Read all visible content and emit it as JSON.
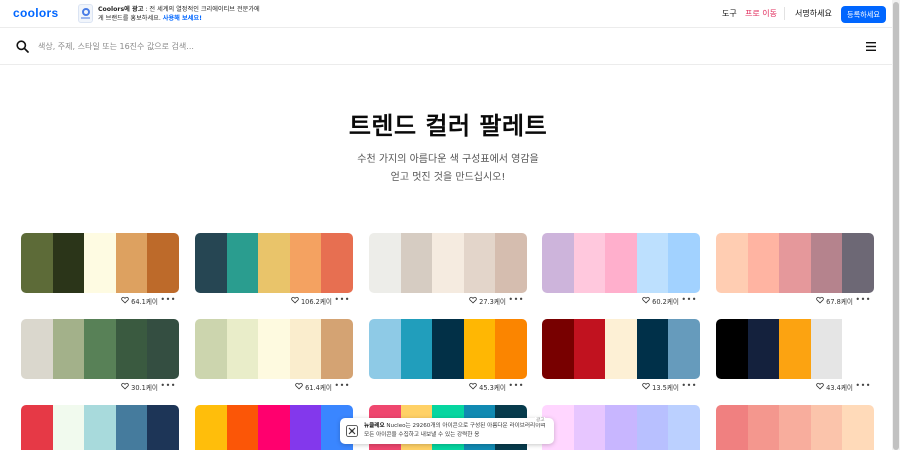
{
  "header": {
    "logo": "coolors",
    "ad": {
      "sponsor": "Coolors에 광고",
      "text": " : 전 세계의 열정적인 크리에이티브 전문가에게 브랜드를 홍보하세요.",
      "cta": "사용해 보세요!"
    },
    "nav": {
      "tools": "도구",
      "pro": "프로 이동",
      "signin": "서명하세요",
      "signup": "등록하세요"
    }
  },
  "search": {
    "placeholder": "색상, 주제, 스타일 또는 16진수 값으로 검색..."
  },
  "hero": {
    "title": "트렌드 컬러 팔레트",
    "subtitle_line1": "수천 가지의 아름다운 색 구성표에서 영감을",
    "subtitle_line2": "얻고 멋진 것을 만드십시오!"
  },
  "palettes": [
    {
      "colors": [
        "#5d6b38",
        "#2b3519",
        "#fefbe2",
        "#dda160",
        "#bd6a2a"
      ],
      "likes": "64.1케이"
    },
    {
      "colors": [
        "#264653",
        "#2a9d8f",
        "#e9c46a",
        "#f4a261",
        "#e76f51"
      ],
      "likes": "106.2케이"
    },
    {
      "colors": [
        "#edede9",
        "#d6ccc2",
        "#f5ebe0",
        "#e3d5ca",
        "#d5bdaf"
      ],
      "likes": "27.3케이"
    },
    {
      "colors": [
        "#cdb4db",
        "#ffc8dd",
        "#ffafcc",
        "#bde0fe",
        "#a2d2ff"
      ],
      "likes": "60.2케이"
    },
    {
      "colors": [
        "#ffcdb2",
        "#ffb4a2",
        "#e5989b",
        "#b5838d",
        "#6d6875"
      ],
      "likes": "67.8케이"
    },
    {
      "colors": [
        "#dad7cd",
        "#a3b18a",
        "#588157",
        "#3a5a40",
        "#344e41"
      ],
      "likes": "30.1케이"
    },
    {
      "colors": [
        "#ccd5ae",
        "#e9edc9",
        "#fefae0",
        "#faedcd",
        "#d4a373"
      ],
      "likes": "61.4케이"
    },
    {
      "colors": [
        "#8ecae6",
        "#219ebc",
        "#023047",
        "#ffb703",
        "#fb8500"
      ],
      "likes": "45.3케이"
    },
    {
      "colors": [
        "#780000",
        "#c1121f",
        "#fdf0d5",
        "#003049",
        "#669bbc"
      ],
      "likes": "13.5케이"
    },
    {
      "colors": [
        "#000000",
        "#14213d",
        "#fca311",
        "#e5e5e5",
        "#ffffff"
      ],
      "likes": "43.4케이"
    },
    {
      "colors": [
        "#e63946",
        "#f1faee",
        "#a8dadc",
        "#457b9d",
        "#1d3557"
      ]
    },
    {
      "colors": [
        "#ffbe0b",
        "#fb5607",
        "#ff006e",
        "#8338ec",
        "#3a86ff"
      ]
    },
    {
      "colors": [
        "#ef476f",
        "#ffd166",
        "#06d6a0",
        "#118ab2",
        "#073b4c"
      ]
    },
    {
      "colors": [
        "#ffd6ff",
        "#e7c6ff",
        "#c8b6ff",
        "#b8c0ff",
        "#bbd0ff"
      ]
    },
    {
      "colors": [
        "#f08080",
        "#f4978e",
        "#f8ad9d",
        "#fbc4ab",
        "#ffdab9"
      ]
    }
  ],
  "toast": {
    "badge": "광고",
    "brand": "뉴클레오",
    "text": " Nucleo는 29260개의 아이콘으로 구성된 아름다운 라이브러리이며 모든 아이콘을 수집하고 내보낼 수 있는 강력한 응"
  }
}
